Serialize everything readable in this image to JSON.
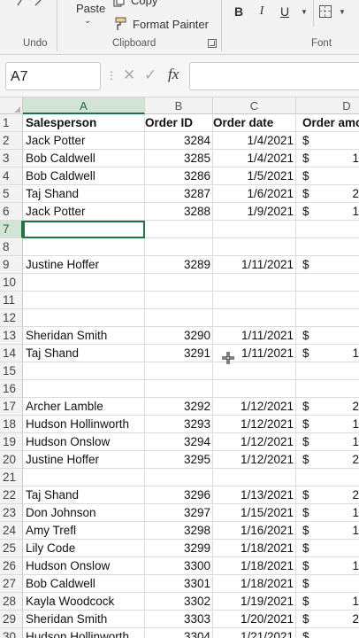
{
  "ribbon": {
    "paste_label": "Paste",
    "copy_label": "Copy",
    "format_painter_label": "Format Painter",
    "groups": {
      "undo": "Undo",
      "clipboard": "Clipboard",
      "font": "Font"
    },
    "bold": "B",
    "italic": "I",
    "underline": "U"
  },
  "formula_bar": {
    "name_box": "A7",
    "fx": "fx",
    "value": ""
  },
  "columns": [
    "A",
    "B",
    "C",
    "D"
  ],
  "header_row": {
    "salesperson": "Salesperson",
    "order_id": "Order ID",
    "order_date": "Order date",
    "order_amount": "Order amo"
  },
  "rows": [
    {
      "n": "1"
    },
    {
      "n": "2",
      "name": "Jack Potter",
      "id": "3284",
      "date": "1/4/2021",
      "cur": "$",
      "amt": ""
    },
    {
      "n": "3",
      "name": "Bob Caldwell",
      "id": "3285",
      "date": "1/4/2021",
      "cur": "$",
      "amt": "1"
    },
    {
      "n": "4",
      "name": "Bob Caldwell",
      "id": "3286",
      "date": "1/5/2021",
      "cur": "$",
      "amt": ""
    },
    {
      "n": "5",
      "name": "Taj Shand",
      "id": "3287",
      "date": "1/6/2021",
      "cur": "$",
      "amt": "2"
    },
    {
      "n": "6",
      "name": "Jack Potter",
      "id": "3288",
      "date": "1/9/2021",
      "cur": "$",
      "amt": "1"
    },
    {
      "n": "7"
    },
    {
      "n": "8"
    },
    {
      "n": "9",
      "name": "Justine Hoffer",
      "id": "3289",
      "date": "1/11/2021",
      "cur": "$",
      "amt": ""
    },
    {
      "n": "10"
    },
    {
      "n": "11"
    },
    {
      "n": "12"
    },
    {
      "n": "13",
      "name": "Sheridan Smith",
      "id": "3290",
      "date": "1/11/2021",
      "cur": "$",
      "amt": ""
    },
    {
      "n": "14",
      "name": "Taj Shand",
      "id": "3291",
      "date": "1/11/2021",
      "cur": "$",
      "amt": "1"
    },
    {
      "n": "15"
    },
    {
      "n": "16"
    },
    {
      "n": "17",
      "name": "Archer Lamble",
      "id": "3292",
      "date": "1/12/2021",
      "cur": "$",
      "amt": "2"
    },
    {
      "n": "18",
      "name": "Hudson Hollinworth",
      "id": "3293",
      "date": "1/12/2021",
      "cur": "$",
      "amt": "1"
    },
    {
      "n": "19",
      "name": "Hudson Onslow",
      "id": "3294",
      "date": "1/12/2021",
      "cur": "$",
      "amt": "1"
    },
    {
      "n": "20",
      "name": "Justine Hoffer",
      "id": "3295",
      "date": "1/12/2021",
      "cur": "$",
      "amt": "2"
    },
    {
      "n": "21"
    },
    {
      "n": "22",
      "name": "Taj Shand",
      "id": "3296",
      "date": "1/13/2021",
      "cur": "$",
      "amt": "2"
    },
    {
      "n": "23",
      "name": "Don Johnson",
      "id": "3297",
      "date": "1/15/2021",
      "cur": "$",
      "amt": "1"
    },
    {
      "n": "24",
      "name": "Amy Trefl",
      "id": "3298",
      "date": "1/16/2021",
      "cur": "$",
      "amt": "1"
    },
    {
      "n": "25",
      "name": "Lily Code",
      "id": "3299",
      "date": "1/18/2021",
      "cur": "$",
      "amt": ""
    },
    {
      "n": "26",
      "name": "Hudson Onslow",
      "id": "3300",
      "date": "1/18/2021",
      "cur": "$",
      "amt": "1"
    },
    {
      "n": "27",
      "name": "Bob Caldwell",
      "id": "3301",
      "date": "1/18/2021",
      "cur": "$",
      "amt": ""
    },
    {
      "n": "28",
      "name": "Kayla Woodcock",
      "id": "3302",
      "date": "1/19/2021",
      "cur": "$",
      "amt": "1"
    },
    {
      "n": "29",
      "name": "Sheridan Smith",
      "id": "3303",
      "date": "1/20/2021",
      "cur": "$",
      "amt": "2"
    },
    {
      "n": "30",
      "name": "Hudson Hollinworth",
      "id": "3304",
      "date": "1/21/2021",
      "cur": "$",
      "amt": ""
    }
  ],
  "selection": {
    "cell": "A7",
    "column": "A",
    "row": "7"
  },
  "colors": {
    "accent": "#217346",
    "selected_header": "#d3e3d6"
  },
  "icons": [
    "undo-icon",
    "paste-chevron-icon",
    "copy-icon",
    "format-painter-icon",
    "dialog-launcher-icon",
    "borders-icon",
    "name-box-chevron-icon",
    "cancel-icon",
    "enter-icon",
    "fx-icon",
    "move-cursor-icon"
  ]
}
